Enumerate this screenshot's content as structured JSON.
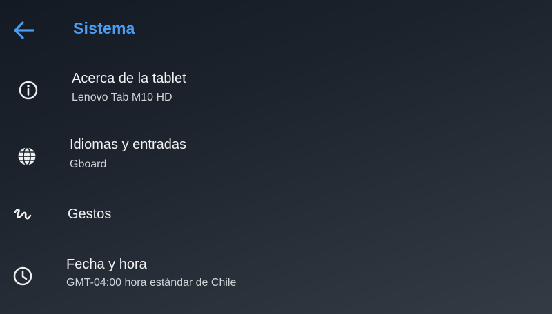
{
  "header": {
    "back_icon": "arrow-back-icon",
    "title": "Sistema"
  },
  "colors": {
    "accent": "#4a9df0",
    "background": "#1c232d",
    "text": "#f2f2f2",
    "secondary_text": "#d2d4d6"
  },
  "items": [
    {
      "icon": "info-icon",
      "label": "Acerca de la tablet",
      "sub": "Lenovo Tab M10 HD"
    },
    {
      "icon": "globe-icon",
      "label": "Idiomas y entradas",
      "sub": "Gboard"
    },
    {
      "icon": "gestures-icon",
      "label": "Gestos",
      "sub": ""
    },
    {
      "icon": "clock-icon",
      "label": "Fecha y hora",
      "sub": "GMT-04:00 hora estándar de Chile"
    }
  ]
}
